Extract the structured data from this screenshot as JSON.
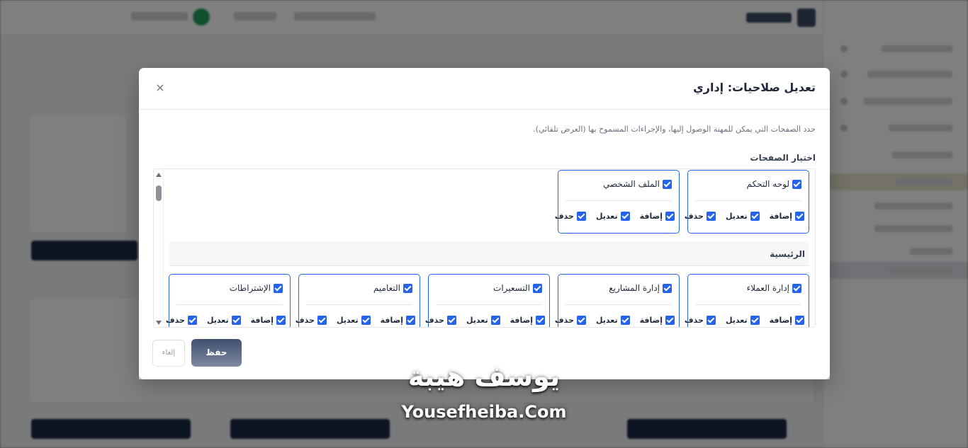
{
  "modal": {
    "title": "تعديل صلاحيات: إداري",
    "close_label": "×",
    "hint": "حدد الصفحات التي يمكن للمهنة الوصول إليها، والإجراءات المسموح بها (العرض تلقائي).",
    "section_label": "اختيار الصفحات",
    "save_label": "حفظ",
    "cancel_label": "إلغاء"
  },
  "actions": {
    "add": "إضافة",
    "edit": "تعديل",
    "delete": "حذف"
  },
  "top_cards": [
    {
      "label": "لوحه التحكم",
      "checked": true
    },
    {
      "label": "الملف الشخصي",
      "checked": true
    }
  ],
  "group": {
    "title": "الرئيسية",
    "cards": [
      {
        "label": "إدارة العملاء",
        "checked": true
      },
      {
        "label": "إدارة المشاريع",
        "checked": true
      },
      {
        "label": "التسعيرات",
        "checked": true
      },
      {
        "label": "التعاميم",
        "checked": true
      },
      {
        "label": "الإشتراطات",
        "checked": true
      }
    ]
  },
  "watermark": {
    "arabic": "يوسف هيبة",
    "english": "Yousefheiba.Com"
  },
  "colors": {
    "accent": "#2563eb",
    "primary_button": "#22345a"
  }
}
